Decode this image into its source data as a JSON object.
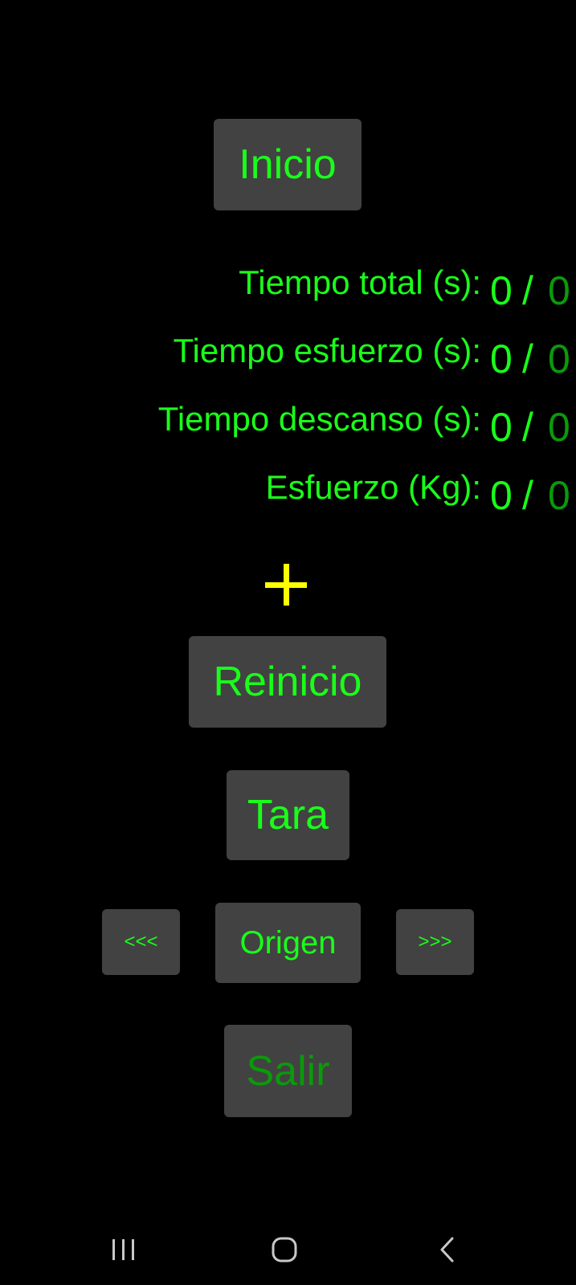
{
  "colors": {
    "background": "#000000",
    "button_bg": "#424242",
    "accent_green": "#1aff1a",
    "dim_green": "#0a9a0a",
    "plus_yellow": "#ffff00",
    "nav_icon": "#c8c8c8"
  },
  "buttons": {
    "inicio": "Inicio",
    "reinicio": "Reinicio",
    "tara": "Tara",
    "prev": "<<<",
    "origen": "Origen",
    "next": ">>>",
    "salir": "Salir"
  },
  "stats": [
    {
      "label": "Tiempo total (s):",
      "current": "0",
      "separator": "/",
      "max": "0"
    },
    {
      "label": "Tiempo esfuerzo (s):",
      "current": "0",
      "separator": "/",
      "max": "0"
    },
    {
      "label": "Tiempo descanso (s):",
      "current": "0",
      "separator": "/",
      "max": "0"
    },
    {
      "label": "Esfuerzo (Kg):",
      "current": "0",
      "separator": "/",
      "max": "0"
    }
  ],
  "icons": {
    "add": "plus-icon",
    "recents": "recents-icon",
    "home": "home-icon",
    "back": "back-icon"
  }
}
